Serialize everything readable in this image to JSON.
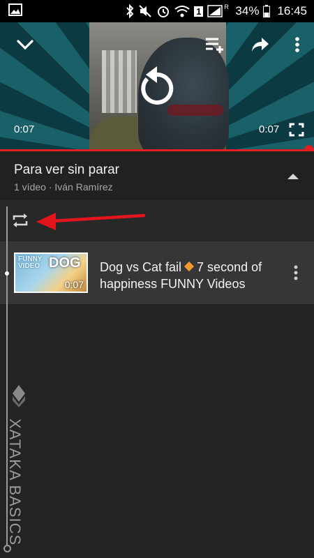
{
  "status_bar": {
    "battery": "34%",
    "time": "16:45",
    "sim_slot": "1",
    "network_label": "R",
    "icons": [
      "image-icon",
      "bluetooth-icon",
      "mute-icon",
      "alarm-icon",
      "wifi-icon",
      "signal-icon",
      "battery-icon"
    ]
  },
  "player": {
    "time_current": "0:07",
    "time_total": "0:07",
    "progress": 1.0,
    "accent_color": "#e02020",
    "icons": [
      "chevron-down-icon",
      "add-to-queue-icon",
      "share-icon",
      "more-vert-icon",
      "replay-icon",
      "fullscreen-icon"
    ]
  },
  "playlist": {
    "title": "Para ver sin parar",
    "subtitle": "1 vídeo · Iván Ramírez",
    "items": [
      {
        "title_part1": "Dog vs Cat fail",
        "title_part2": "7 second of happiness FUNNY Videos",
        "duration": "0:07",
        "thumb_text_left": "FUNNY VIDEO",
        "thumb_text_right": "DOG"
      }
    ]
  },
  "watermark": {
    "text": "XATAKA BASICS"
  }
}
